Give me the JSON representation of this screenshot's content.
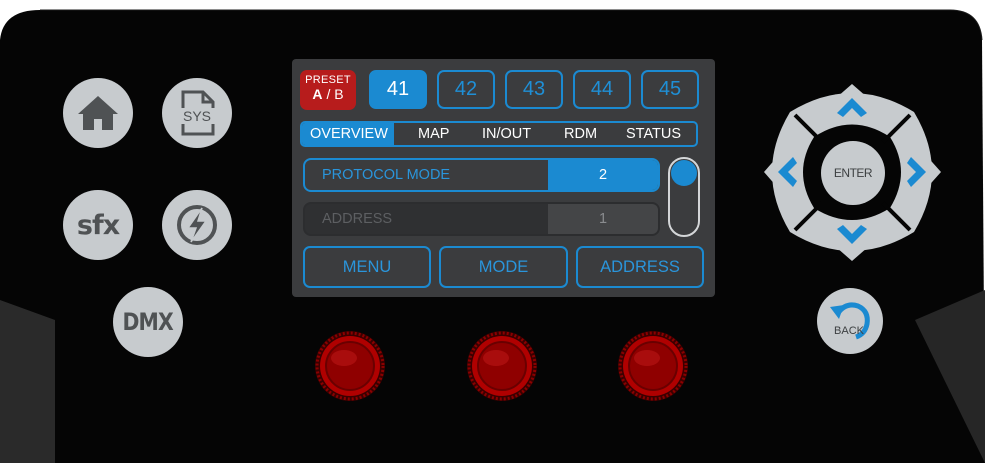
{
  "colors": {
    "accent": "#1b8ad1",
    "preset_red": "#b71c1c",
    "knob_red": "#b00000",
    "button_gray": "#c7cbce",
    "panel": "#050505",
    "side": "#2a2a2a",
    "screen": "#3b3c3e"
  },
  "left_buttons": {
    "home": {
      "icon": "home-icon"
    },
    "sys": {
      "icon": "sys-file-icon",
      "label": "SYS"
    },
    "sfx": {
      "label": "sfx"
    },
    "power": {
      "icon": "lightning-circle-icon"
    },
    "dmx": {
      "label": "DMX"
    }
  },
  "screen": {
    "preset": {
      "title": "PRESET",
      "active": "A",
      "separator": "/",
      "inactive": "B"
    },
    "channels": [
      "41",
      "42",
      "43",
      "44",
      "45"
    ],
    "active_channel": "41",
    "tabs": [
      "OVERVIEW",
      "MAP",
      "IN/OUT",
      "RDM",
      "STATUS"
    ],
    "active_tab": "OVERVIEW",
    "rows": [
      {
        "label": "PROTOCOL MODE",
        "value": "2"
      },
      {
        "label": "ADDRESS",
        "value": "1"
      }
    ],
    "softkeys": [
      "MENU",
      "MODE",
      "ADDRESS"
    ]
  },
  "nav": {
    "enter_label": "ENTER",
    "back_label": "BACK",
    "icons": [
      "arrow-up-icon",
      "arrow-down-icon",
      "arrow-left-icon",
      "arrow-right-icon",
      "back-arrow-icon"
    ]
  },
  "knobs": [
    "knob-1",
    "knob-2",
    "knob-3"
  ]
}
